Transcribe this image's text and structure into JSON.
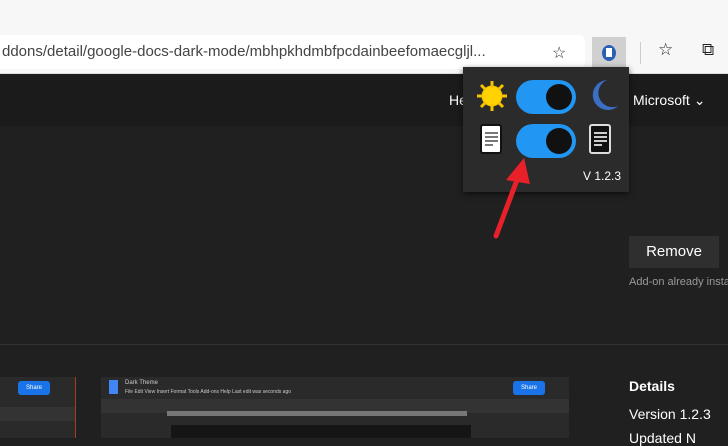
{
  "browser": {
    "url": "ddons/detail/google-docs-dark-mode/mbhpkhdmbfpcdainbeefomaecgljl...",
    "icons": [
      "add-favorite-icon",
      "extension-icon",
      "favorites-icon",
      "collections-icon"
    ]
  },
  "header": {
    "nav_partial": "He",
    "microsoft": "Microsoft"
  },
  "popup": {
    "theme_toggle_on": true,
    "docs_toggle_on": true,
    "version": "V 1.2.3",
    "accent": "#2196f3"
  },
  "main": {
    "remove_label": "Remove",
    "installed_text": "Add-on already installe",
    "details_title": "Details",
    "version": "Version 1.2.3",
    "updated_partial": "Updated N"
  },
  "screenshots": {
    "share_label": "Share",
    "doc_title": "Dark Theme",
    "menu": "File  Edit  View  Insert  Format  Tools  Add-ons  Help   Last edit was seconds ago"
  }
}
